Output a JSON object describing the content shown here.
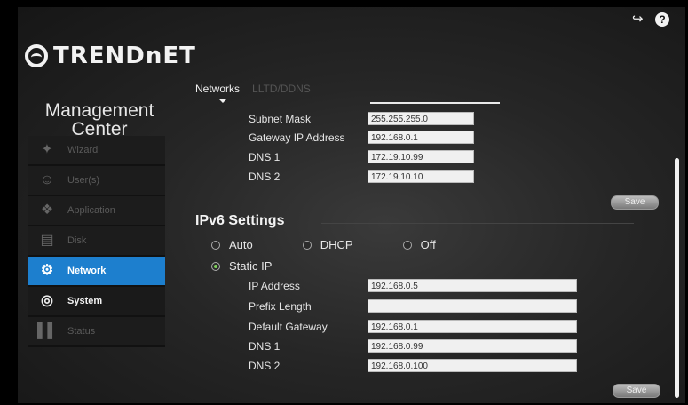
{
  "brand": {
    "logo_text": "TRENDnET"
  },
  "title": {
    "line1": "Management",
    "line2": "Center"
  },
  "sidebar": {
    "items": [
      {
        "label": "Wizard",
        "icon": "wand-icon"
      },
      {
        "label": "User(s)",
        "icon": "users-icon"
      },
      {
        "label": "Application",
        "icon": "app-icon"
      },
      {
        "label": "Disk",
        "icon": "disk-icon"
      },
      {
        "label": "Network",
        "icon": "network-icon"
      },
      {
        "label": "System",
        "icon": "system-icon"
      },
      {
        "label": "Status",
        "icon": "status-icon"
      }
    ]
  },
  "tabs": [
    {
      "label": "Networks",
      "active": true
    },
    {
      "label": "LLTD/DDNS",
      "active": false
    }
  ],
  "ipv4": {
    "subnet_mask_label": "Subnet Mask",
    "subnet_mask": "255.255.255.0",
    "gateway_label": "Gateway IP Address",
    "gateway": "192.168.0.1",
    "dns1_label": "DNS 1",
    "dns1": "172.19.10.99",
    "dns2_label": "DNS 2",
    "dns2": "172.19.10.10",
    "save_label": "Save"
  },
  "ipv6": {
    "title": "IPv6 Settings",
    "options": {
      "auto": "Auto",
      "dhcp": "DHCP",
      "off": "Off",
      "static": "Static IP"
    },
    "selected": "static",
    "ip_label": "IP Address",
    "ip": "192.168.0.5",
    "prefix_label": "Prefix Length",
    "prefix": "",
    "gateway_label": "Default Gateway",
    "gateway": "192.168.0.1",
    "dns1_label": "DNS 1",
    "dns1": "192.168.0.99",
    "dns2_label": "DNS 2",
    "dns2": "192.168.0.100",
    "save_label": "Save"
  },
  "colors": {
    "accent": "#1d7fce",
    "radio_on": "#7fd15a"
  }
}
